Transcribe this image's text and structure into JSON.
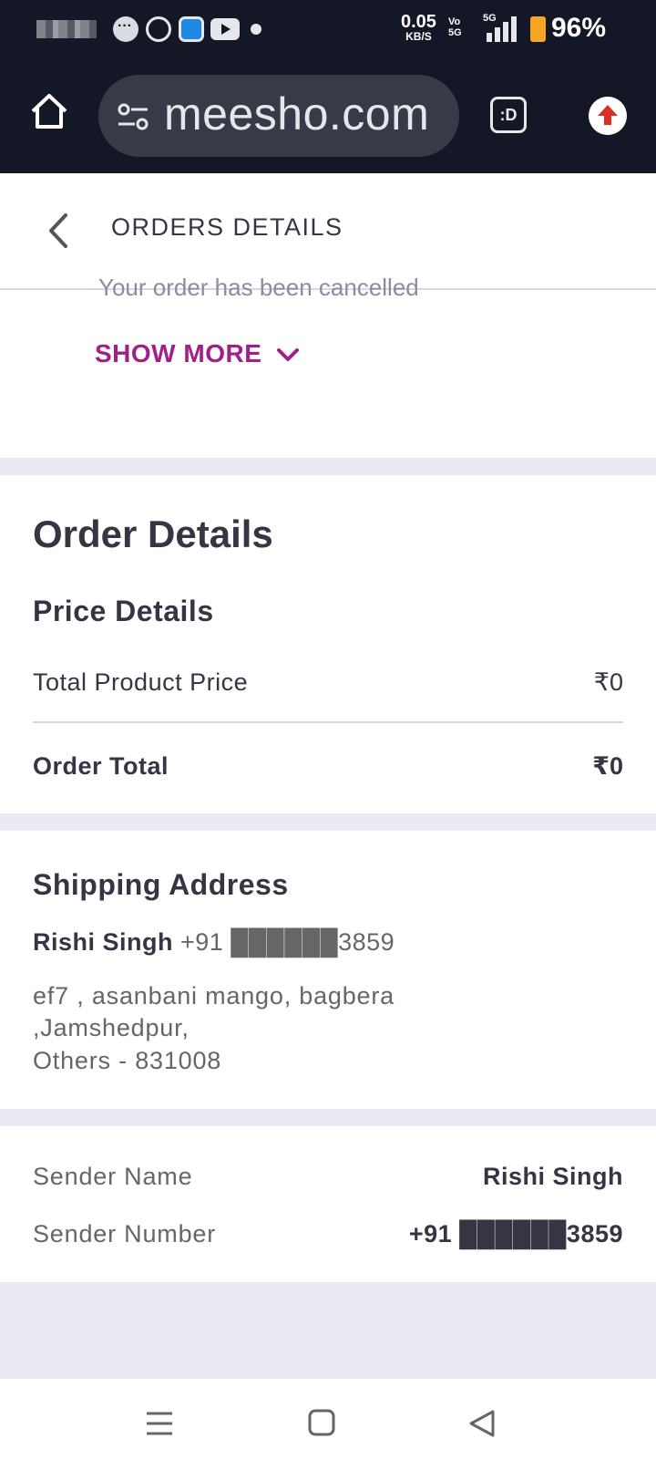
{
  "status_bar": {
    "net_speed": "0.05",
    "net_unit": "KB/S",
    "volte": "Vo\n5G",
    "network": "5G",
    "battery": "96%"
  },
  "browser": {
    "url": "meesho.com",
    "tabs_label": ":D"
  },
  "header": {
    "title": "ORDERS DETAILS"
  },
  "timeline": {
    "partial_text": "Your order has been cancelled",
    "show_more": "SHOW MORE"
  },
  "order_details": {
    "title": "Order Details",
    "price_details_title": "Price Details",
    "rows": [
      {
        "label": "Total Product Price",
        "value": "₹0"
      },
      {
        "label": "Order Total",
        "value": "₹0"
      }
    ]
  },
  "shipping": {
    "title": "Shipping Address",
    "name": "Rishi Singh",
    "phone": "+91 ██████3859",
    "address_lines": [
      "ef7 , asanbani mango, bagbera",
      ",Jamshedpur,",
      "Others - 831008"
    ]
  },
  "sender": {
    "name_label": "Sender Name",
    "name_value": "Rishi Singh",
    "number_label": "Sender Number",
    "number_value": "+91 ██████3859"
  },
  "icons": {
    "home": "home-icon",
    "tune": "tune-icon",
    "upload": "upload-arrow-icon",
    "back": "chevron-left-icon",
    "show_more": "chevron-down-icon",
    "nav_menu": "menu-icon",
    "nav_home": "square-icon",
    "nav_back": "triangle-back-icon"
  },
  "colors": {
    "accent": "#9f2089",
    "chrome": "#141826",
    "separator": "#eaeaf2"
  }
}
